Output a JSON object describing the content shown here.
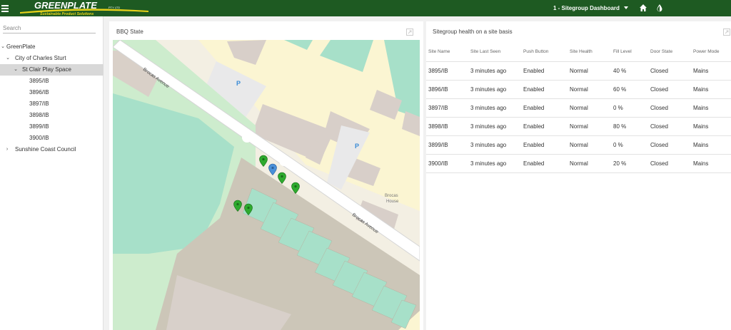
{
  "app": {
    "logo_main": "GREENPLATE",
    "logo_suffix": "PTY LTD",
    "logo_tagline": "Sustainable Product Solutions",
    "sitegroup_selected": "1 - Sitegroup Dashboard",
    "brand_color": "#1e5a22"
  },
  "sidebar": {
    "search_placeholder": "Search",
    "tree": [
      {
        "label": "GreenPlate",
        "expanded": true
      },
      {
        "label": "City of Charles Sturt",
        "expanded": true
      },
      {
        "label": "St Clair Play Space",
        "expanded": true,
        "selected": true
      },
      {
        "label": "3895/IB"
      },
      {
        "label": "3896/IB"
      },
      {
        "label": "3897/IB"
      },
      {
        "label": "3898/IB"
      },
      {
        "label": "3899/IB"
      },
      {
        "label": "3900/IB"
      },
      {
        "label": "Sunshine Coast Council",
        "expanded": false
      }
    ]
  },
  "map_panel": {
    "title": "BBQ State",
    "labels": {
      "street_1": "Brocas Avenue",
      "street_2": "Brocas Avenue",
      "parking": "P",
      "building_1": "Brocas",
      "building_2": "House"
    },
    "marker_colors": {
      "ok": "#2eaa2e",
      "selected": "#4a90d9"
    }
  },
  "table_panel": {
    "title": "Sitegroup health on a site basis",
    "columns": [
      "Site Name",
      "Site Last Seen",
      "Push Button",
      "Site Health",
      "Fill Level",
      "Door State",
      "Power Mode"
    ],
    "rows": [
      [
        "3895/IB",
        "3 minutes ago",
        "Enabled",
        "Normal",
        "40 %",
        "Closed",
        "Mains"
      ],
      [
        "3896/IB",
        "3 minutes ago",
        "Enabled",
        "Normal",
        "60 %",
        "Closed",
        "Mains"
      ],
      [
        "3897/IB",
        "3 minutes ago",
        "Enabled",
        "Normal",
        "0 %",
        "Closed",
        "Mains"
      ],
      [
        "3898/IB",
        "3 minutes ago",
        "Enabled",
        "Normal",
        "80 %",
        "Closed",
        "Mains"
      ],
      [
        "3899/IB",
        "3 minutes ago",
        "Enabled",
        "Normal",
        "0 %",
        "Closed",
        "Mains"
      ],
      [
        "3900/IB",
        "3 minutes ago",
        "Enabled",
        "Normal",
        "20 %",
        "Closed",
        "Mains"
      ]
    ]
  }
}
